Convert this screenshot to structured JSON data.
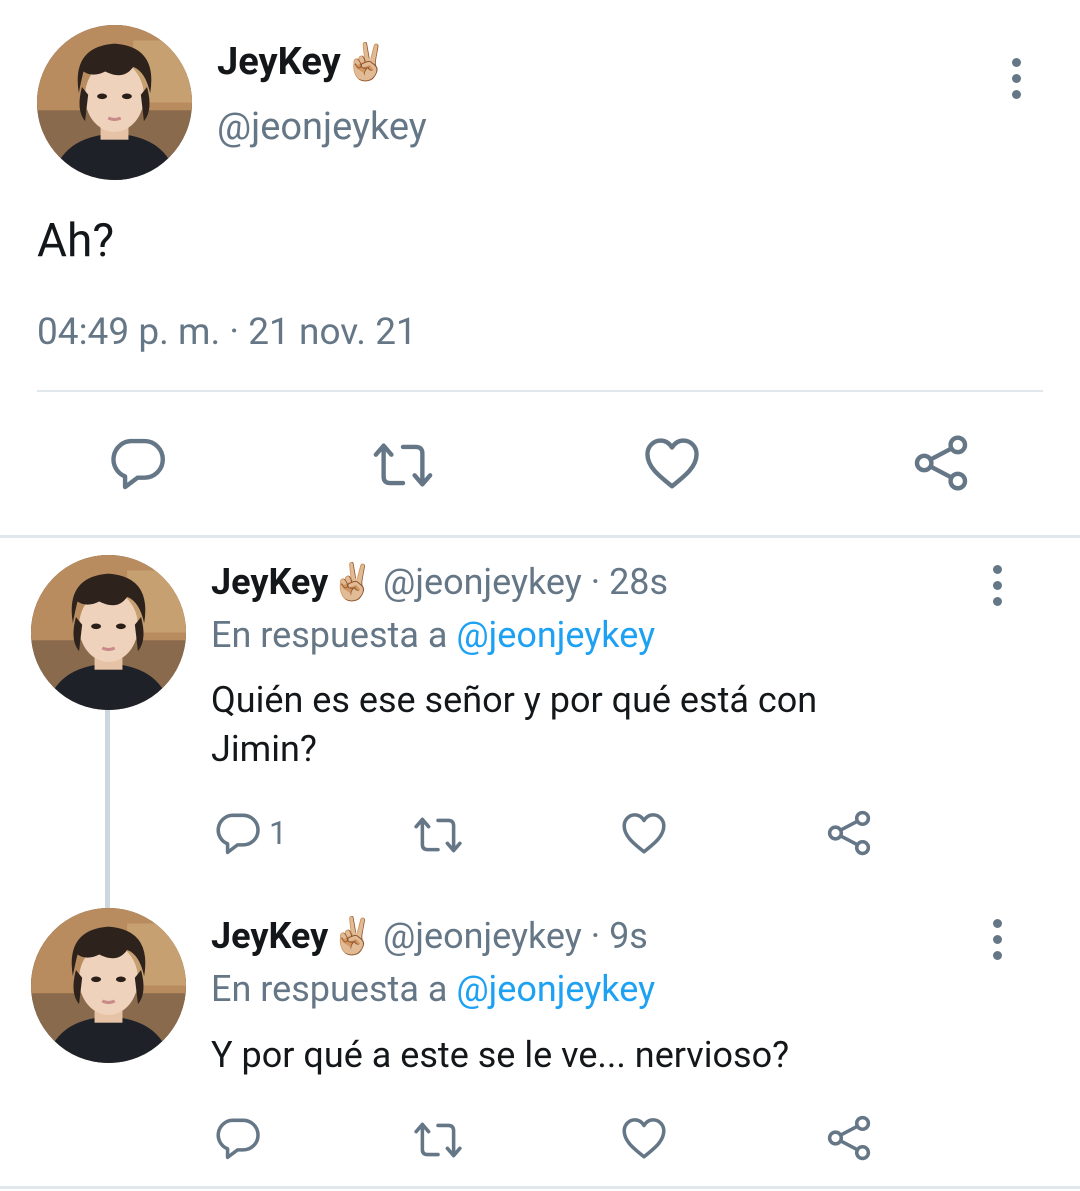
{
  "main_tweet": {
    "display_name": "JeyKey",
    "name_emoji": "✌🏼",
    "handle": "@jeonjeykey",
    "text": "Ah?",
    "timestamp": "04:49 p. m. · 21 nov. 21",
    "actions": [
      "reply-icon",
      "retweet-icon",
      "like-icon",
      "share-icon"
    ]
  },
  "replies": [
    {
      "display_name": "JeyKey",
      "name_emoji": "✌🏼",
      "handle": "@jeonjeykey",
      "time": "· 28s",
      "reply_prefix": "En respuesta a",
      "reply_to": "@jeonjeykey",
      "text_line1": "Quién es ese señor y por qué está con",
      "text_line2": "Jimin?",
      "reply_count": "1"
    },
    {
      "display_name": "JeyKey",
      "name_emoji": "✌🏼",
      "handle": "@jeonjeykey",
      "time": "· 9s",
      "reply_prefix": "En respuesta a",
      "reply_to": "@jeonjeykey",
      "text_line1": "Y por qué a este se le ve... nervioso?",
      "reply_count": ""
    }
  ],
  "colors": {
    "text": "#14171a",
    "muted": "#657786",
    "link": "#1da1f2",
    "divider": "#e1e8ed",
    "thread_line": "#ccd6dd"
  }
}
